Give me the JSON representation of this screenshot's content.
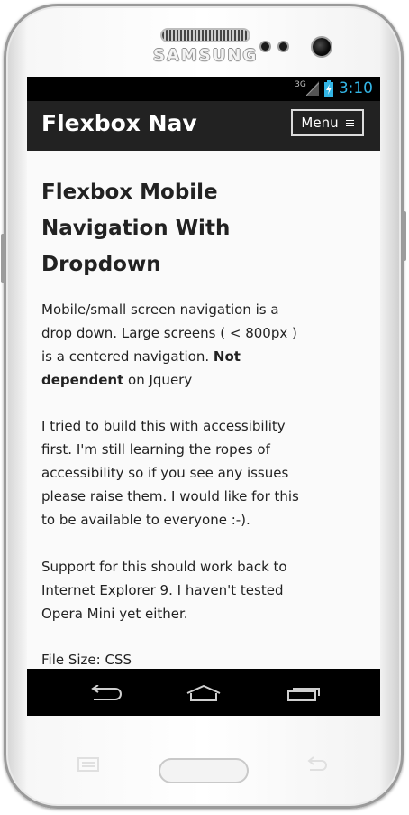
{
  "device": {
    "brand": "SAMSUNG"
  },
  "statusbar": {
    "network": "3G",
    "time": "3:10",
    "time_color": "#33b5e5"
  },
  "navbar": {
    "title": "Flexbox Nav",
    "menu_label": "Menu",
    "background": "#222222"
  },
  "article": {
    "heading": "Flexbox Mobile Navigation With Dropdown",
    "p1_text": "Mobile/small screen navigation is a drop down. Large screens ( < 800px ) is a centered navigation. ",
    "p1_bold": "Not dependent",
    "p1_tail": " on Jquery",
    "p2": "I tried to build this with accessibility first. I'm still learning the ropes of accessibility so if you see any issues please raise them. I would like for this to be available to everyone :-).",
    "p3": "Support for this should work back to Internet Explorer 9. I haven't tested Opera Mini yet either.",
    "p4": "File Size: CSS"
  },
  "navkeys": [
    "back-icon",
    "home-icon",
    "recent-apps-icon"
  ],
  "hardware_keys": [
    "menu-icon",
    "back-icon"
  ]
}
